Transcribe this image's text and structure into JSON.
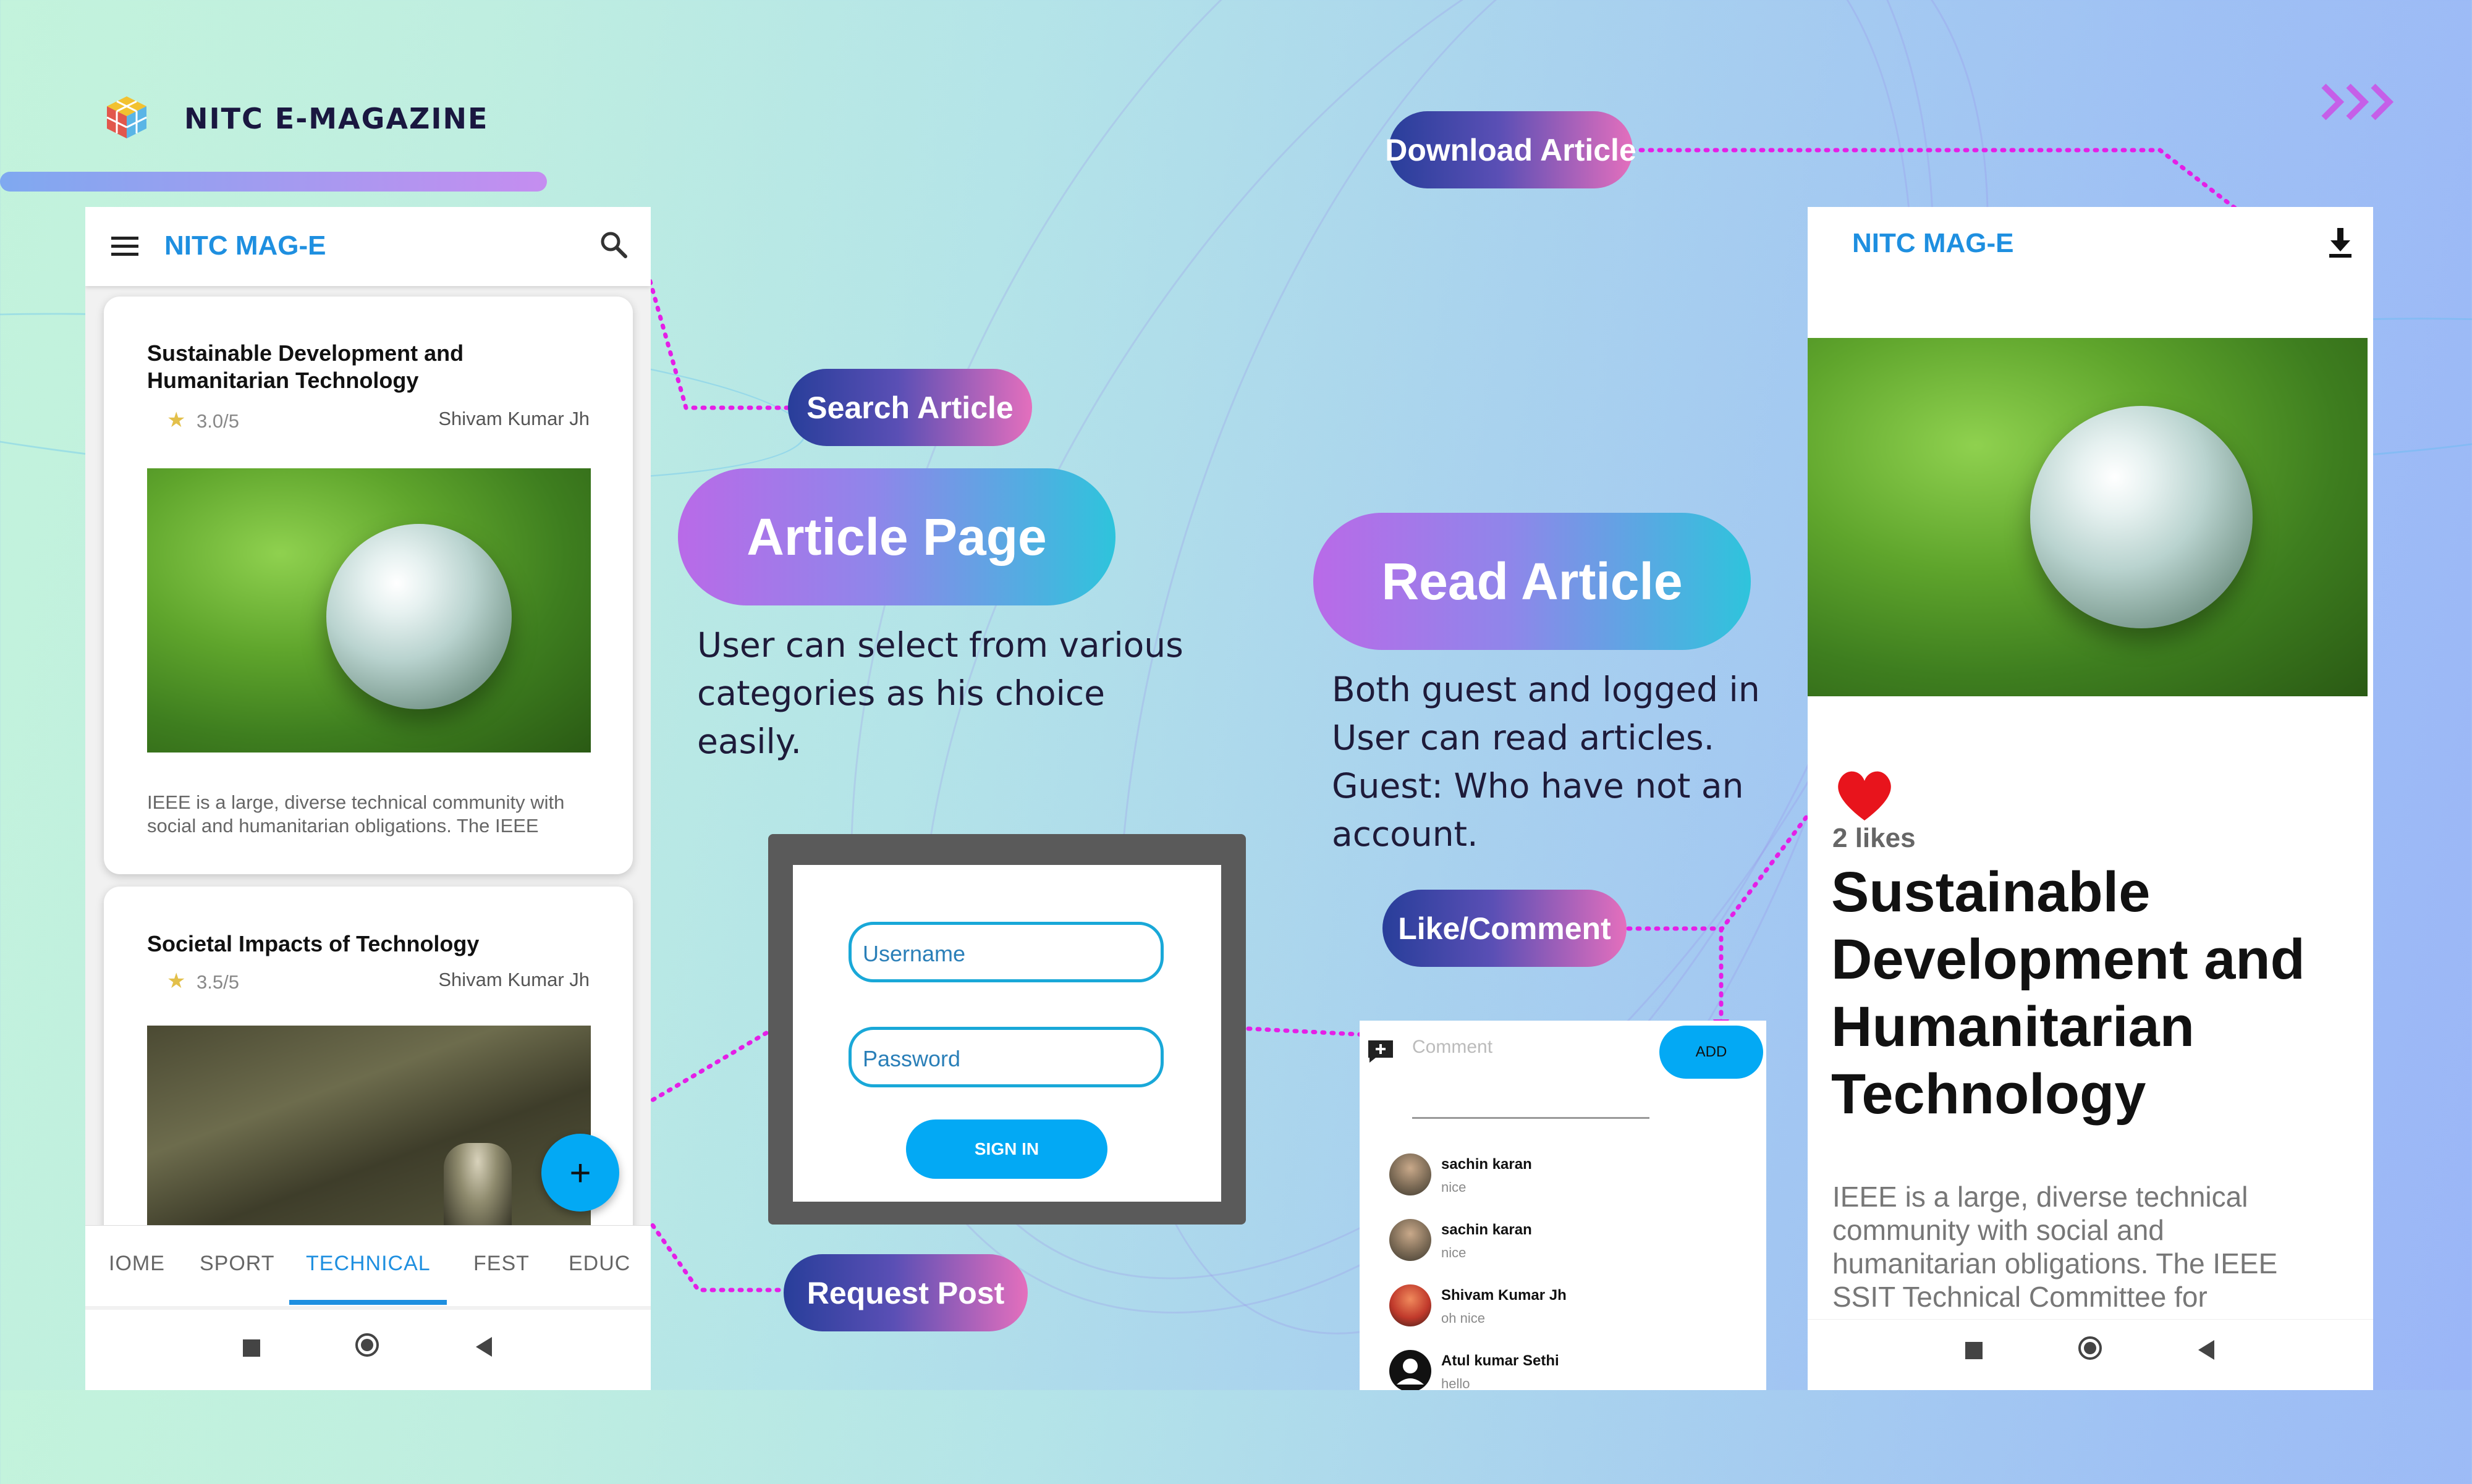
{
  "brand": {
    "title": "NITC E-MAGAZINE"
  },
  "callouts": {
    "download": "Download Article",
    "search": "Search Article",
    "article_page": "Article Page",
    "read_article": "Read Article",
    "like_comment": "Like/Comment",
    "request_post": "Request Post"
  },
  "descriptions": {
    "article_page": [
      "User can select from various",
      "categories as his choice",
      "easily."
    ],
    "read_article": [
      "Both guest and logged in",
      "User can read articles.",
      "Guest: Who have not an",
      "account."
    ]
  },
  "phone_left": {
    "app_title": "NITC MAG-E",
    "articles": [
      {
        "title_line1": "Sustainable Development and",
        "title_line2": "Humanitarian Technology",
        "rating": "3.0/5",
        "author": "Shivam Kumar Jh",
        "excerpt_line1": "IEEE is a large, diverse technical community with",
        "excerpt_line2": "social and humanitarian obligations. The IEEE"
      },
      {
        "title": "Societal Impacts of Technology",
        "rating": "3.5/5",
        "author": "Shivam Kumar Jh"
      }
    ],
    "fab_label": "+",
    "tabs": [
      "IOME",
      "SPORT",
      "TECHNICAL",
      "FEST",
      "EDUC"
    ],
    "active_tab": "TECHNICAL"
  },
  "login": {
    "username_placeholder": "Username",
    "password_placeholder": "Password",
    "signin_label": "SIGN IN"
  },
  "comments": {
    "placeholder": "Comment",
    "add_label": "ADD",
    "items": [
      {
        "name": "sachin karan",
        "text": "nice"
      },
      {
        "name": "sachin karan",
        "text": "nice"
      },
      {
        "name": "Shivam Kumar Jh",
        "text": "oh nice"
      },
      {
        "name": "Atul kumar Sethi",
        "text": "hello"
      }
    ]
  },
  "phone_right": {
    "app_title": "NITC MAG-E",
    "likes": "2 likes",
    "title_lines": [
      "Sustainable",
      "Development and",
      "Humanitarian",
      "Technology"
    ],
    "body_lines": [
      "IEEE is a large, diverse technical",
      "community with social and",
      "humanitarian obligations. The IEEE",
      "SSIT Technical Committee for"
    ]
  },
  "colors": {
    "accent_blue": "#03a9f4",
    "app_title_blue": "#1e8fe0",
    "heart_red": "#e8141c",
    "dotted_magenta": "#e41fe6"
  }
}
